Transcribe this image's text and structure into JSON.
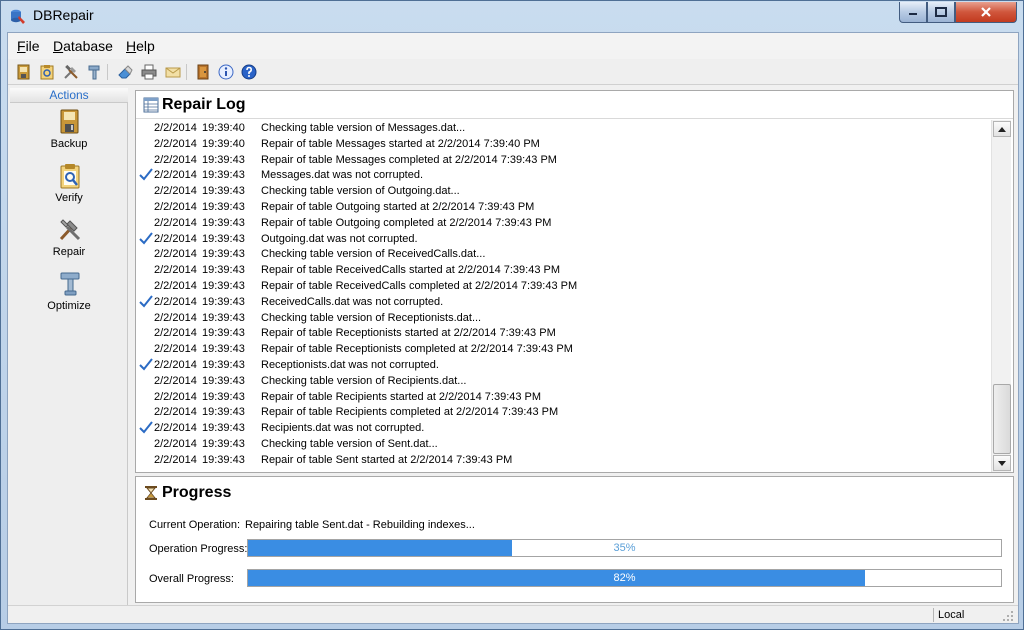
{
  "window": {
    "title": "DBRepair"
  },
  "menu": [
    {
      "accel": "F",
      "rest": "ile"
    },
    {
      "accel": "D",
      "rest": "atabase"
    },
    {
      "accel": "H",
      "rest": "elp"
    }
  ],
  "toolbar": {
    "icons": [
      "backup-icon",
      "verify-icon",
      "repair-icon",
      "optimize-icon",
      "eraser-icon",
      "print-icon",
      "mail-icon",
      "exit-door-icon",
      "info-icon",
      "help-icon"
    ]
  },
  "sidebar": {
    "header": "Actions",
    "items": [
      {
        "label": "Backup",
        "icon": "backup-icon"
      },
      {
        "label": "Verify",
        "icon": "verify-icon"
      },
      {
        "label": "Repair",
        "icon": "repair-icon"
      },
      {
        "label": "Optimize",
        "icon": "optimize-icon"
      }
    ]
  },
  "repair_log": {
    "title": "Repair Log",
    "rows": [
      {
        "check": false,
        "date": "2/2/2014",
        "time": "19:39:40",
        "message": "Checking table version of Messages.dat..."
      },
      {
        "check": false,
        "date": "2/2/2014",
        "time": "19:39:40",
        "message": "Repair of table Messages started at 2/2/2014 7:39:40 PM"
      },
      {
        "check": false,
        "date": "2/2/2014",
        "time": "19:39:43",
        "message": "Repair of table Messages completed at 2/2/2014 7:39:43 PM"
      },
      {
        "check": true,
        "date": "2/2/2014",
        "time": "19:39:43",
        "message": "Messages.dat was not corrupted."
      },
      {
        "check": false,
        "date": "2/2/2014",
        "time": "19:39:43",
        "message": "Checking table version of Outgoing.dat..."
      },
      {
        "check": false,
        "date": "2/2/2014",
        "time": "19:39:43",
        "message": "Repair of table Outgoing started at 2/2/2014 7:39:43 PM"
      },
      {
        "check": false,
        "date": "2/2/2014",
        "time": "19:39:43",
        "message": "Repair of table Outgoing completed at 2/2/2014 7:39:43 PM"
      },
      {
        "check": true,
        "date": "2/2/2014",
        "time": "19:39:43",
        "message": "Outgoing.dat was not corrupted."
      },
      {
        "check": false,
        "date": "2/2/2014",
        "time": "19:39:43",
        "message": "Checking table version of ReceivedCalls.dat..."
      },
      {
        "check": false,
        "date": "2/2/2014",
        "time": "19:39:43",
        "message": "Repair of table ReceivedCalls started at 2/2/2014 7:39:43 PM"
      },
      {
        "check": false,
        "date": "2/2/2014",
        "time": "19:39:43",
        "message": "Repair of table ReceivedCalls completed at 2/2/2014 7:39:43 PM"
      },
      {
        "check": true,
        "date": "2/2/2014",
        "time": "19:39:43",
        "message": "ReceivedCalls.dat was not corrupted."
      },
      {
        "check": false,
        "date": "2/2/2014",
        "time": "19:39:43",
        "message": "Checking table version of Receptionists.dat..."
      },
      {
        "check": false,
        "date": "2/2/2014",
        "time": "19:39:43",
        "message": "Repair of table Receptionists started at 2/2/2014 7:39:43 PM"
      },
      {
        "check": false,
        "date": "2/2/2014",
        "time": "19:39:43",
        "message": "Repair of table Receptionists completed at 2/2/2014 7:39:43 PM"
      },
      {
        "check": true,
        "date": "2/2/2014",
        "time": "19:39:43",
        "message": "Receptionists.dat was not corrupted."
      },
      {
        "check": false,
        "date": "2/2/2014",
        "time": "19:39:43",
        "message": "Checking table version of Recipients.dat..."
      },
      {
        "check": false,
        "date": "2/2/2014",
        "time": "19:39:43",
        "message": "Repair of table Recipients started at 2/2/2014 7:39:43 PM"
      },
      {
        "check": false,
        "date": "2/2/2014",
        "time": "19:39:43",
        "message": "Repair of table Recipients completed at 2/2/2014 7:39:43 PM"
      },
      {
        "check": true,
        "date": "2/2/2014",
        "time": "19:39:43",
        "message": "Recipients.dat was not corrupted."
      },
      {
        "check": false,
        "date": "2/2/2014",
        "time": "19:39:43",
        "message": "Checking table version of Sent.dat..."
      },
      {
        "check": false,
        "date": "2/2/2014",
        "time": "19:39:43",
        "message": "Repair of table Sent started at 2/2/2014 7:39:43 PM"
      }
    ]
  },
  "progress": {
    "title": "Progress",
    "current_operation_label": "Current Operation:",
    "current_operation_value": "Repairing table Sent.dat - Rebuilding indexes...",
    "operation_label": "Operation Progress:",
    "operation_percent": 35,
    "operation_text": "35%",
    "overall_label": "Overall Progress:",
    "overall_percent": 82,
    "overall_text": "82%"
  },
  "statusbar": {
    "location": "Local"
  },
  "colors": {
    "progress_fill": "#3a8de3",
    "check": "#2b6bc4",
    "actions_header": "#2a6fc9",
    "close_button": "#c94a30"
  }
}
